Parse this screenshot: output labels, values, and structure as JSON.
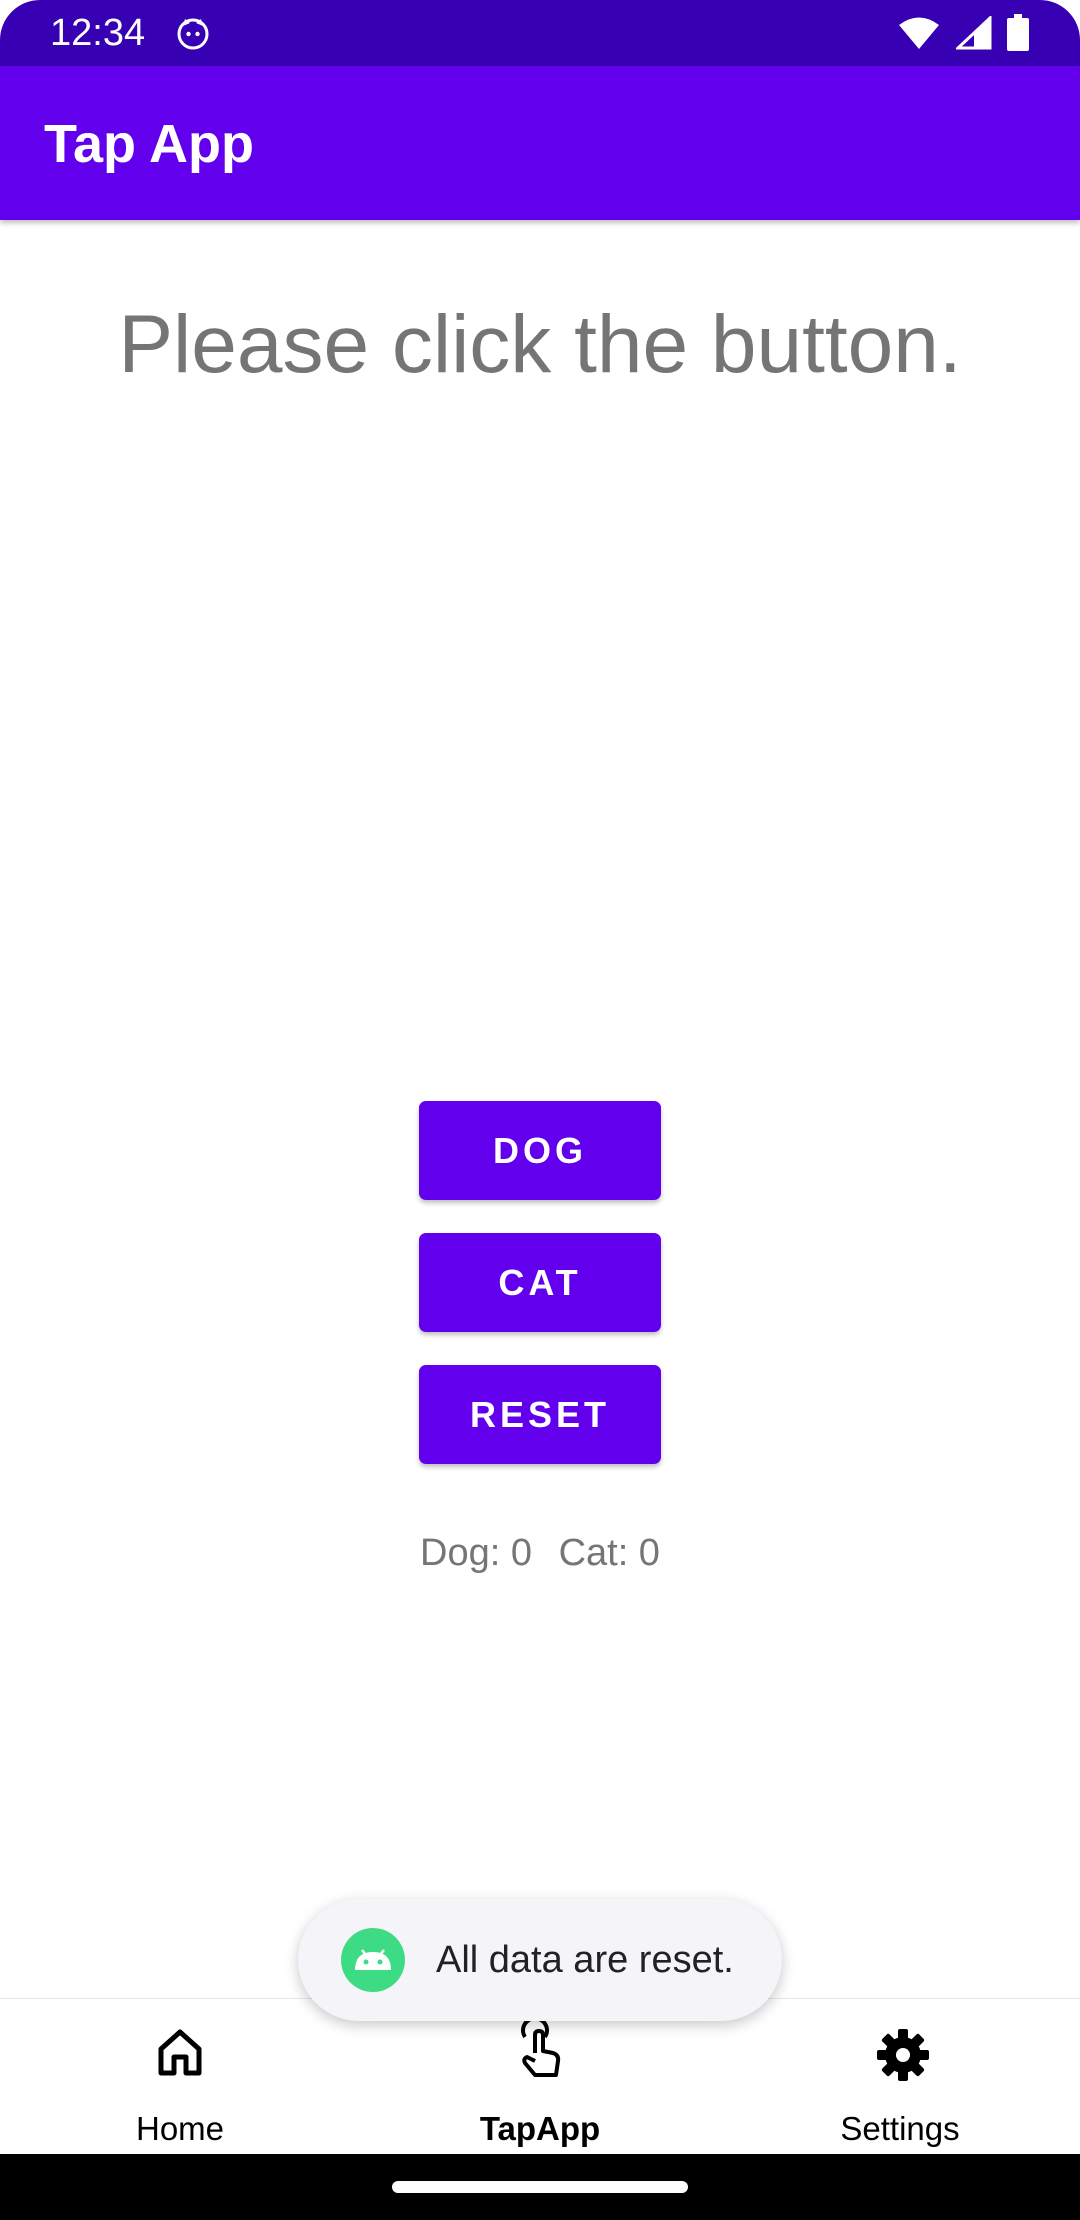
{
  "status_bar": {
    "time": "12:34",
    "icons": [
      "cat-notification-icon",
      "wifi-icon",
      "signal-icon",
      "battery-icon"
    ]
  },
  "app_bar": {
    "title": "Tap App"
  },
  "main": {
    "prompt": "Please click the button.",
    "buttons": {
      "dog": "DOG",
      "cat": "CAT",
      "reset": "RESET"
    },
    "counts": {
      "dog": "Dog: 0",
      "cat": "Cat: 0"
    }
  },
  "toast": {
    "message": "All data are reset.",
    "icon": "android-icon"
  },
  "bottom_nav": {
    "items": [
      {
        "label": "Home",
        "icon": "home-icon"
      },
      {
        "label": "TapApp",
        "icon": "touch-icon",
        "active": true
      },
      {
        "label": "Settings",
        "icon": "gear-icon"
      }
    ]
  },
  "colors": {
    "primary": "#6200ee",
    "primary_dark": "#3700b3",
    "text_secondary": "#757575"
  }
}
